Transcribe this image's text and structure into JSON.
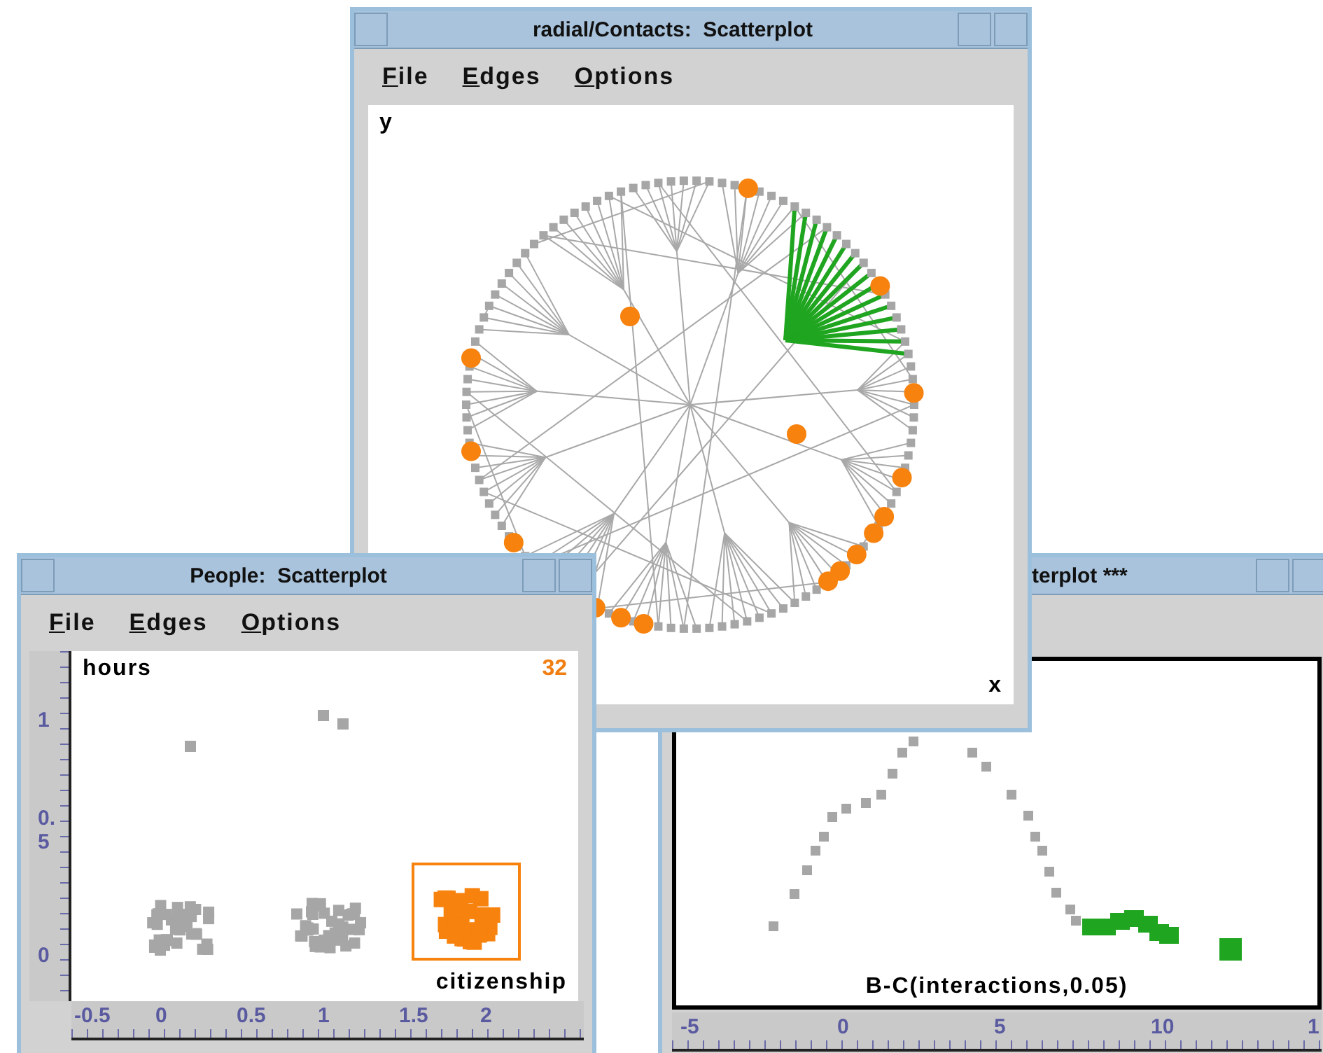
{
  "contacts_window": {
    "title": "radial/Contacts:  Scatterplot",
    "menu": [
      "File",
      "Edges",
      "Options"
    ],
    "y_label": "y",
    "x_label": "x"
  },
  "interactions_window": {
    "title": "terplot ***",
    "x_label": "B-C(interactions,0.05)",
    "x_ruler": [
      "-5",
      "0",
      "5",
      "10",
      "1"
    ]
  },
  "people_window": {
    "title": "People:  Scatterplot",
    "menu": [
      "File",
      "Edges",
      "Options"
    ],
    "y_label": "hours",
    "count": "32",
    "x_label": "citizenship",
    "x_ruler": [
      "-0.5",
      "0",
      "0.5",
      "1",
      "1.5",
      "2"
    ],
    "y_ruler": [
      "1",
      "0.5",
      "0"
    ]
  }
}
